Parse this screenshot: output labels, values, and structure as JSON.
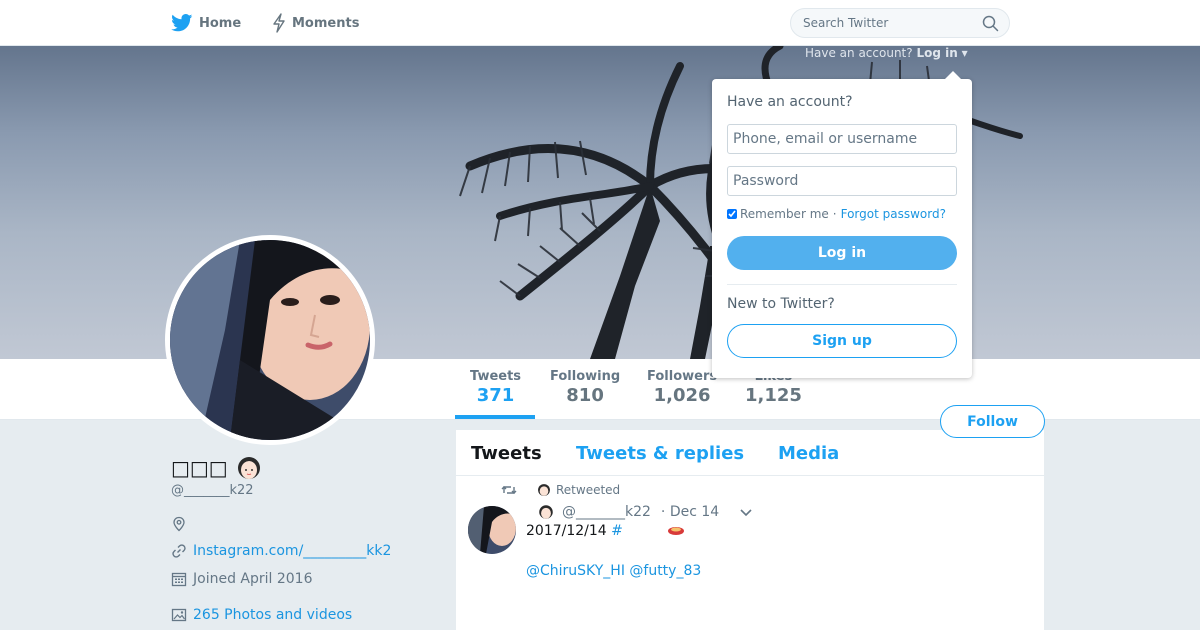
{
  "nav": {
    "home_label": "Home",
    "moments_label": "Moments",
    "search_placeholder": "Search Twitter"
  },
  "banner": {
    "login_prompt": "Have an account?",
    "login_link": "Log in"
  },
  "login_dropdown": {
    "title": "Have an account?",
    "username_placeholder": "Phone, email or username",
    "password_placeholder": "Password",
    "remember_label": "Remember me",
    "separator": "·",
    "forgot_label": "Forgot password?",
    "login_button": "Log in",
    "new_prompt": "New to Twitter?",
    "signup_button": "Sign up"
  },
  "stats": [
    {
      "label": "Tweets",
      "value": "371"
    },
    {
      "label": "Following",
      "value": "810"
    },
    {
      "label": "Followers",
      "value": "1,026"
    },
    {
      "label": "Likes",
      "value": "1,125"
    }
  ],
  "follow_button": "Follow",
  "profile": {
    "name": "□□□",
    "handle": "@_______k22",
    "website": "Instagram.com/_________kk2",
    "joined": "Joined April 2016",
    "photos": "265 Photos and videos"
  },
  "timeline": {
    "tabs": [
      "Tweets",
      "Tweets & replies",
      "Media"
    ],
    "tweet": {
      "retweeted_label": "Retweeted",
      "handle": "@_______k22",
      "date": "· Dec 14",
      "text": "2017/12/14",
      "hashtag": "#",
      "mentions": "@ChiruSKY_HI @futty_83"
    }
  },
  "colors": {
    "accent": "#1da1f2",
    "link": "#1b95e0",
    "background": "#e6ecf0"
  }
}
